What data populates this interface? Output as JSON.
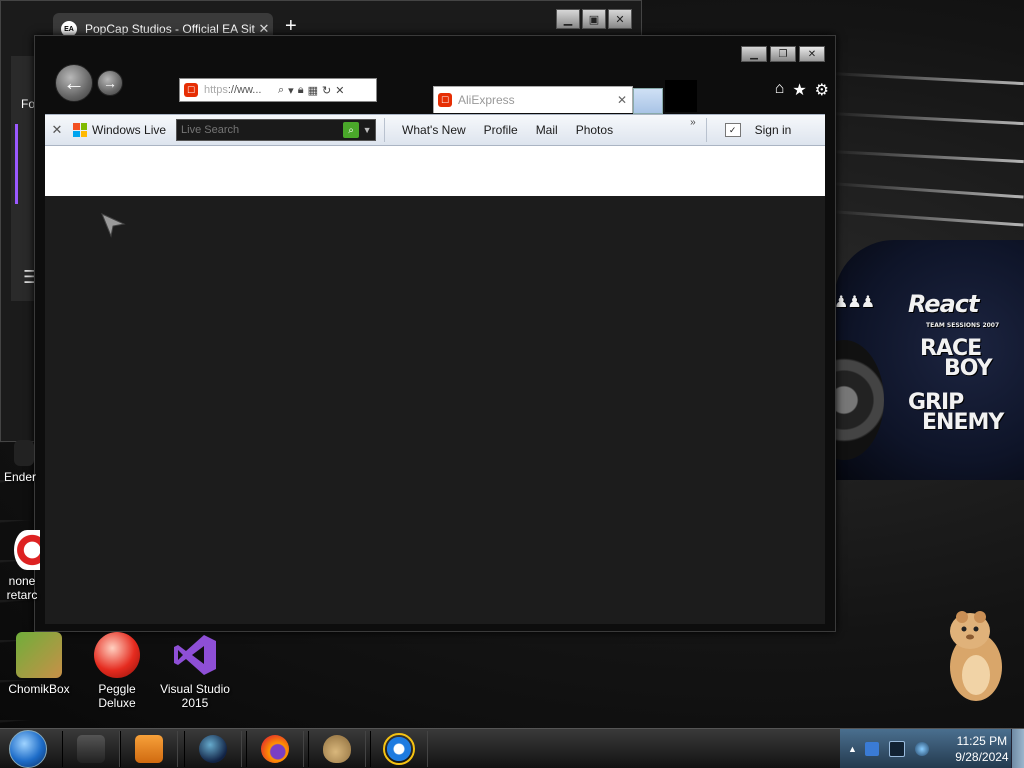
{
  "background_window": {
    "tab_title": "PopCap Studios - Official EA Sit",
    "tab_icon_text": "EA",
    "tab_close": "✕",
    "new_tab": "+",
    "partial_label": "Fo"
  },
  "ie_window": {
    "address_url_prefix": "https",
    "address_url_rest": "://ww...",
    "active_tab_title": "AliExpress",
    "active_tab_close": "✕"
  },
  "wl_toolbar": {
    "brand": "Windows Live",
    "search_placeholder": "Live Search",
    "links": [
      "What's New",
      "Profile",
      "Mail",
      "Photos"
    ],
    "more": "»",
    "sign_in": "Sign in"
  },
  "desktop_icons": [
    {
      "label": "Ender"
    },
    {
      "label": "none retarc"
    },
    {
      "label": "ChomikBox"
    },
    {
      "label": "Peggle Deluxe"
    },
    {
      "label": "Visual Studio 2015"
    }
  ],
  "decals": {
    "react": "React",
    "react_sub": "TEAM SESSIONS 2007",
    "race": "RACE",
    "boy": "BOY",
    "grip": "GRIP",
    "enemy": "ENEMY"
  },
  "clock": {
    "time": "11:25 PM",
    "date": "9/28/2024"
  },
  "colors": {
    "wl_green": "#4aa82a",
    "ali_red": "#e62e04",
    "tray_blue": "#4a6f8f"
  }
}
